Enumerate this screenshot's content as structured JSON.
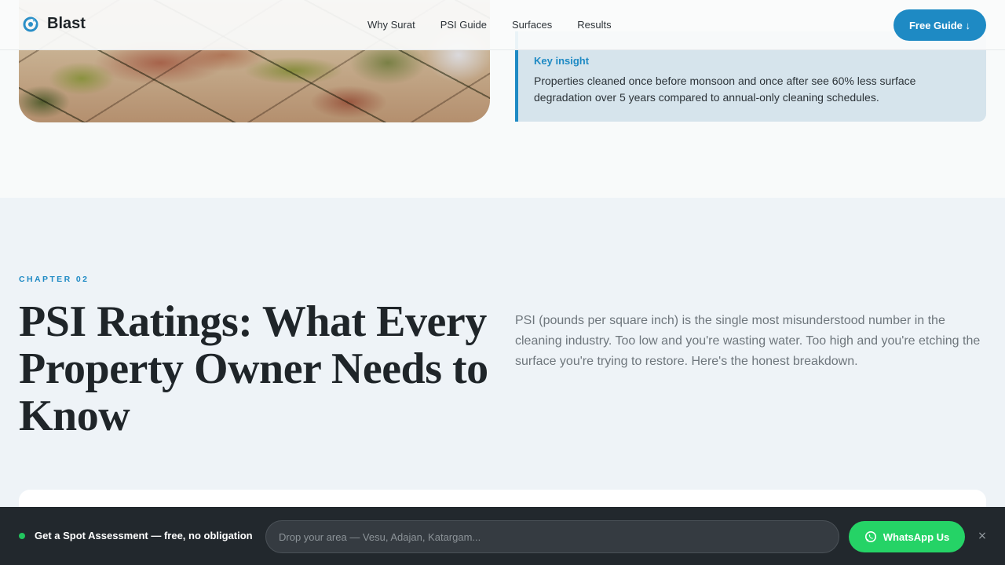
{
  "nav": {
    "brand": "Blast",
    "logo_icon": "water-drop-logo-icon",
    "links": [
      "Why Surat",
      "PSI Guide",
      "Surfaces",
      "Results"
    ],
    "cta_label": "Free Guide ↓"
  },
  "previous_section": {
    "insight_title": "Key insight",
    "insight_text": "Properties cleaned once before monsoon and once after see 60% less surface degradation over 5 years compared to annual-only cleaning schedules."
  },
  "chapter": {
    "label": "CHAPTER 02",
    "heading": "PSI Ratings: What Every Property Owner Needs to Know",
    "intro": "PSI (pounds per square inch) is the single most misunderstood number in the cleaning industry. Too low and you're wasting water. Too high and you're etching the surface you're trying to restore. Here's the honest breakdown."
  },
  "bottom_bar": {
    "text": "Get a Spot Assessment — free, no obligation",
    "input_placeholder": "Drop your area — Vesu, Adajan, Katargam...",
    "whatsapp_label": "WhatsApp Us",
    "close_label": "×"
  },
  "colors": {
    "accent": "#1e8ac4",
    "whatsapp": "#25d366",
    "status_dot": "#22c55e",
    "bar_bg": "#22282d"
  }
}
